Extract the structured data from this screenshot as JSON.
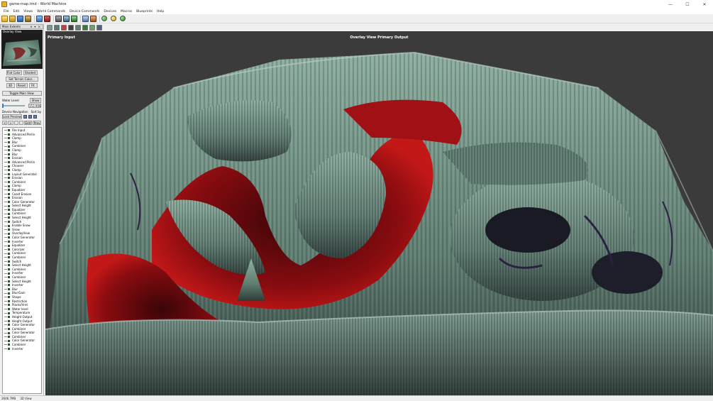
{
  "window": {
    "title": "game-map.tmd - World Machine",
    "minimize": "—",
    "maximize": "☐",
    "close": "✕"
  },
  "menu": [
    "File",
    "Edit",
    "Views",
    "World Commands",
    "Device Commands",
    "Devices",
    "Macros",
    "Blueprints",
    "Help"
  ],
  "panel": {
    "title": "Main Extents",
    "header_btns": "x  ▾  ×",
    "overlay_label": "Overlay View",
    "flat_color": "Flat Color",
    "shaded": "Shaded",
    "set_terrain_color": "Set Terrain Color...",
    "btn_3d": "3D",
    "btn_reset": "Reset",
    "btn_fit": "Fit",
    "toggle_main_view": "Toggle Main View",
    "water_level": "Water Level",
    "show": "Show",
    "water_value": "153.909",
    "device_navigation": "Device Navigation",
    "sort_by": "Sort by",
    "lock_preview": "Lock Preview",
    "nav_prev": "<",
    "nav_next": ">",
    "edit": "Edit",
    "prev": "Prev"
  },
  "devices": [
    "File Input",
    "Advanced Perlin",
    "Clamp",
    "Blur",
    "Combiner",
    "Clamp",
    "Blur",
    "Erosion",
    "Advanced Perlin",
    "Chooser",
    "Clamp",
    "Layout Generator",
    "Erosion",
    "Combiner",
    "Clamp",
    "Equalizer",
    "Coast Erosion",
    "Erosion",
    "Color Generator",
    "Select Height",
    "Equalizer",
    "Combiner",
    "Select Height",
    "Switch",
    "Enable Snow",
    "Snow",
    "OverlayView",
    "Color Generator",
    "Inverter",
    "Equalizer",
    "Colorizer",
    "Combiner",
    "Combiner",
    "Switch",
    "Select Height",
    "Combiner",
    "Inverter",
    "Combiner",
    "Select Height",
    "Inverter",
    "Blur",
    "Blur/Gain",
    "Shape",
    "Restriction",
    "Plants/Vrnt",
    "Water level",
    "Temperature",
    "Height Output",
    "Height Output",
    "Color Generator",
    "Combiner",
    "Color Generator",
    "Combiner",
    "Color Generator",
    "Combiner",
    "Inverter"
  ],
  "viewport": {
    "primary_input": "Primary Input",
    "view_title": "Overlay View Primary Output"
  },
  "status": {
    "memory": "2606.7MB",
    "mode": "3D View"
  },
  "colors": {
    "terrain_green": "#6f8f7e",
    "valley_red": "#b01010",
    "bg": "#3b3b3b"
  },
  "icons": {
    "toolbar": [
      "new-icon",
      "open-icon",
      "save-icon",
      "build-icon",
      "explorer-icon",
      "layout-icon",
      "render-icon",
      "preview-icon",
      "green-ball-icon",
      "yellow-ball-icon",
      "green-globe-icon"
    ]
  }
}
